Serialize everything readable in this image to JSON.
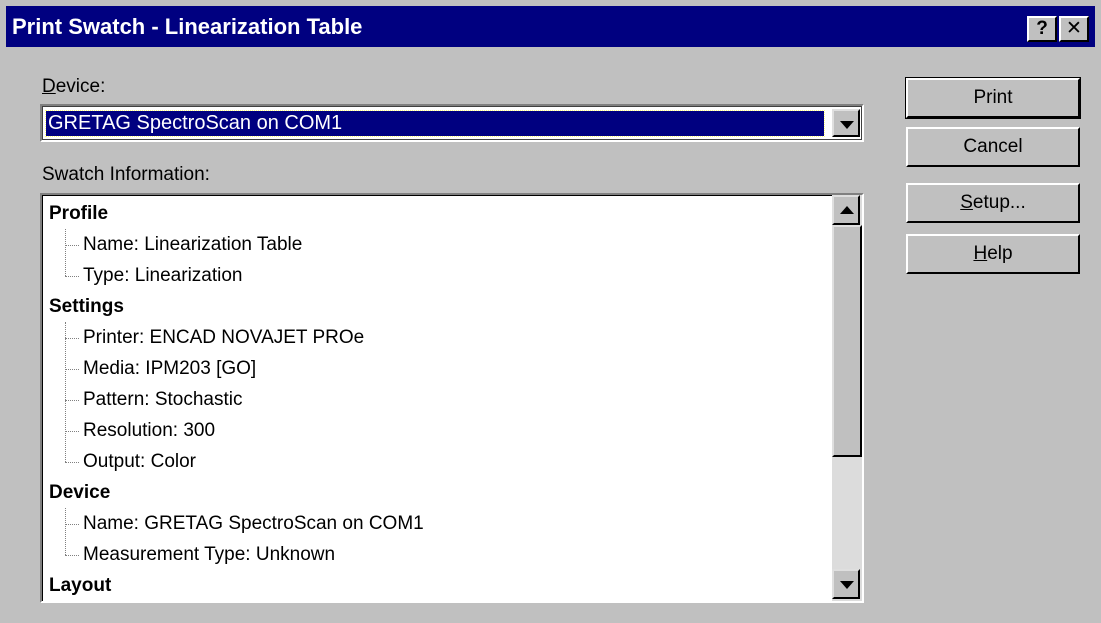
{
  "window": {
    "title": "Print Swatch - Linearization Table",
    "help_button": "?",
    "close_button": "✕"
  },
  "device": {
    "label_accel": "D",
    "label_rest": "evice:",
    "selected": "GRETAG SpectroScan on COM1"
  },
  "swatch": {
    "label": "Swatch Information:",
    "tree": [
      {
        "kind": "group",
        "text": "Profile"
      },
      {
        "kind": "child",
        "text": "Name: Linearization Table"
      },
      {
        "kind": "child",
        "text": "Type: Linearization"
      },
      {
        "kind": "group",
        "text": "Settings"
      },
      {
        "kind": "child",
        "text": "Printer: ENCAD NOVAJET PROe"
      },
      {
        "kind": "child",
        "text": "Media: IPM203 [GO]"
      },
      {
        "kind": "child",
        "text": "Pattern: Stochastic"
      },
      {
        "kind": "child",
        "text": "Resolution: 300"
      },
      {
        "kind": "child",
        "text": "Output: Color"
      },
      {
        "kind": "group",
        "text": "Device"
      },
      {
        "kind": "child",
        "text": "Name: GRETAG SpectroScan on COM1"
      },
      {
        "kind": "child",
        "text": "Measurement Type: Unknown"
      },
      {
        "kind": "group",
        "text": "Layout"
      }
    ]
  },
  "buttons": {
    "print": "Print",
    "cancel": "Cancel",
    "setup_accel": "S",
    "setup_rest": "etup...",
    "help_accel": "H",
    "help_rest": "elp"
  }
}
